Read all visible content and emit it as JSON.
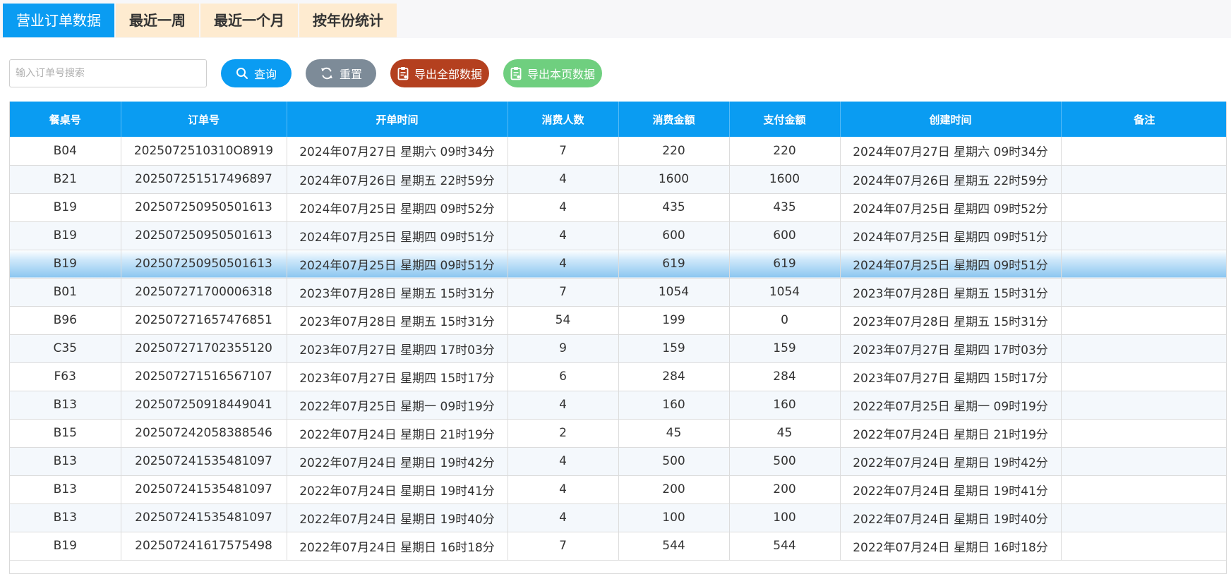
{
  "tabs": [
    {
      "label": "营业订单数据",
      "active": true
    },
    {
      "label": "最近一周",
      "active": false
    },
    {
      "label": "最近一个月",
      "active": false
    },
    {
      "label": "按年份统计",
      "active": false
    }
  ],
  "toolbar": {
    "search_placeholder": "输入订单号搜索",
    "search_value": "",
    "query_label": "查询",
    "reset_label": "重置",
    "export_all_label": "导出全部数据",
    "export_page_label": "导出本页数据"
  },
  "icons": {
    "query": "search-icon",
    "reset": "refresh-icon",
    "export_all": "clipboard-icon",
    "export_page": "clipboard-icon"
  },
  "colors": {
    "primary": "#0a9cf2",
    "tab_inactive": "#feebd0",
    "reset": "#7d8b98",
    "export_all": "#b4401f",
    "export_page": "#6fcf7f"
  },
  "table": {
    "columns": [
      "餐桌号",
      "订单号",
      "开单时间",
      "消费人数",
      "消费金额",
      "支付金额",
      "创建时间",
      "备注"
    ],
    "selected_row": 4,
    "rows": [
      [
        "B04",
        "2025072510310O8919",
        "2024年07月27日 星期六 09时34分",
        "7",
        "220",
        "220",
        "2024年07月27日 星期六 09时34分",
        ""
      ],
      [
        "B21",
        "202507251517496897",
        "2024年07月26日 星期五 22时59分",
        "4",
        "1600",
        "1600",
        "2024年07月26日 星期五 22时59分",
        ""
      ],
      [
        "B19",
        "202507250950501613",
        "2024年07月25日 星期四 09时52分",
        "4",
        "435",
        "435",
        "2024年07月25日 星期四 09时52分",
        ""
      ],
      [
        "B19",
        "202507250950501613",
        "2024年07月25日 星期四 09时51分",
        "4",
        "600",
        "600",
        "2024年07月25日 星期四 09时51分",
        ""
      ],
      [
        "B19",
        "202507250950501613",
        "2024年07月25日 星期四 09时51分",
        "4",
        "619",
        "619",
        "2024年07月25日 星期四 09时51分",
        ""
      ],
      [
        "B01",
        "202507271700006318",
        "2023年07月28日 星期五 15时31分",
        "7",
        "1054",
        "1054",
        "2023年07月28日 星期五 15时31分",
        ""
      ],
      [
        "B96",
        "202507271657476851",
        "2023年07月28日 星期五 15时31分",
        "54",
        "199",
        "0",
        "2023年07月28日 星期五 15时31分",
        ""
      ],
      [
        "C35",
        "202507271702355120",
        "2023年07月27日 星期四 17时03分",
        "9",
        "159",
        "159",
        "2023年07月27日 星期四 17时03分",
        ""
      ],
      [
        "F63",
        "202507271516567107",
        "2023年07月27日 星期四 15时17分",
        "6",
        "284",
        "284",
        "2023年07月27日 星期四 15时17分",
        ""
      ],
      [
        "B13",
        "202507250918449041",
        "2022年07月25日 星期一 09时19分",
        "4",
        "160",
        "160",
        "2022年07月25日 星期一 09时19分",
        ""
      ],
      [
        "B15",
        "202507242058388546",
        "2022年07月24日 星期日 21时19分",
        "2",
        "45",
        "45",
        "2022年07月24日 星期日 21时19分",
        ""
      ],
      [
        "B13",
        "202507241535481097",
        "2022年07月24日 星期日 19时42分",
        "4",
        "500",
        "500",
        "2022年07月24日 星期日 19时42分",
        ""
      ],
      [
        "B13",
        "202507241535481097",
        "2022年07月24日 星期日 19时41分",
        "4",
        "200",
        "200",
        "2022年07月24日 星期日 19时41分",
        ""
      ],
      [
        "B13",
        "202507241535481097",
        "2022年07月24日 星期日 19时40分",
        "4",
        "100",
        "100",
        "2022年07月24日 星期日 19时40分",
        ""
      ],
      [
        "B19",
        "202507241617575498",
        "2022年07月24日 星期日 16时18分",
        "7",
        "544",
        "544",
        "2022年07月24日 星期日 16时18分",
        ""
      ]
    ]
  }
}
